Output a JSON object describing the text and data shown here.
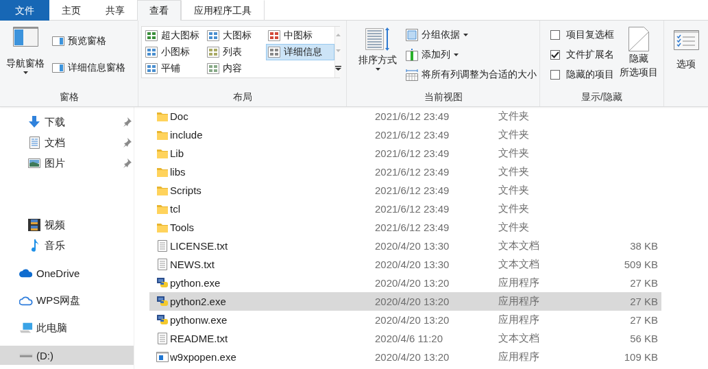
{
  "tabs": [
    {
      "label": "文件",
      "kind": "file",
      "selected": false
    },
    {
      "label": "主页",
      "kind": "normal",
      "selected": false
    },
    {
      "label": "共享",
      "kind": "normal",
      "selected": false
    },
    {
      "label": "查看",
      "kind": "normal",
      "selected": true
    },
    {
      "label": "应用程序工具",
      "kind": "context",
      "selected": false
    }
  ],
  "ribbon": {
    "panes": {
      "label": "窗格",
      "navigation_pane": "导航窗格",
      "preview_pane": "预览窗格",
      "details_pane": "详细信息窗格"
    },
    "layout": {
      "label": "布局",
      "items": [
        {
          "label": "超大图标",
          "kind": "xl",
          "selected": false
        },
        {
          "label": "大图标",
          "kind": "large",
          "selected": false
        },
        {
          "label": "中图标",
          "kind": "medium",
          "selected": false
        },
        {
          "label": "小图标",
          "kind": "small",
          "selected": false
        },
        {
          "label": "列表",
          "kind": "list",
          "selected": false
        },
        {
          "label": "详细信息",
          "kind": "details",
          "selected": true
        },
        {
          "label": "平铺",
          "kind": "tiles",
          "selected": false
        },
        {
          "label": "内容",
          "kind": "content",
          "selected": false
        }
      ]
    },
    "current_view": {
      "label": "当前视图",
      "sort_by": "排序方式",
      "group_by": "分组依据",
      "add_columns": "添加列",
      "size_all_columns": "将所有列调整为合适的大小"
    },
    "show_hide": {
      "label": "显示/隐藏",
      "checkboxes": [
        {
          "label": "项目复选框",
          "checked": false
        },
        {
          "label": "文件扩展名",
          "checked": true
        },
        {
          "label": "隐藏的项目",
          "checked": false
        }
      ],
      "hide_selected": [
        "隐藏",
        "所选项目"
      ]
    },
    "options": {
      "label": "选项"
    }
  },
  "sidebar": {
    "items": [
      {
        "label": "下载",
        "kind": "downloads",
        "pinned": true,
        "selected": false
      },
      {
        "label": "文档",
        "kind": "documents",
        "pinned": true,
        "selected": false
      },
      {
        "label": "图片",
        "kind": "pictures",
        "pinned": true,
        "selected": false
      },
      {
        "label": "视频",
        "kind": "videos",
        "pinned": false,
        "selected": false
      },
      {
        "label": "音乐",
        "kind": "music",
        "pinned": false,
        "selected": false
      },
      {
        "label": "OneDrive",
        "kind": "onedrive",
        "pinned": false,
        "selected": false
      },
      {
        "label": "WPS网盘",
        "kind": "wps",
        "pinned": false,
        "selected": false
      },
      {
        "label": "此电脑",
        "kind": "pc",
        "pinned": false,
        "selected": false
      },
      {
        "label": "(D:)",
        "kind": "drive",
        "pinned": false,
        "selected": true
      }
    ]
  },
  "files": [
    {
      "name": "Doc",
      "date": "2021/6/12 23:49",
      "type": "文件夹",
      "kind": "folder",
      "selected": false
    },
    {
      "name": "include",
      "date": "2021/6/12 23:49",
      "type": "文件夹",
      "kind": "folder",
      "selected": false
    },
    {
      "name": "Lib",
      "date": "2021/6/12 23:49",
      "type": "文件夹",
      "kind": "folder",
      "selected": false
    },
    {
      "name": "libs",
      "date": "2021/6/12 23:49",
      "type": "文件夹",
      "kind": "folder",
      "selected": false
    },
    {
      "name": "Scripts",
      "date": "2021/6/12 23:49",
      "type": "文件夹",
      "kind": "folder",
      "selected": false
    },
    {
      "name": "tcl",
      "date": "2021/6/12 23:49",
      "type": "文件夹",
      "kind": "folder",
      "selected": false
    },
    {
      "name": "Tools",
      "date": "2021/6/12 23:49",
      "type": "文件夹",
      "kind": "folder",
      "selected": false
    },
    {
      "name": "LICENSE.txt",
      "date": "2020/4/20 13:30",
      "type": "文本文档",
      "size": "38 KB",
      "kind": "text",
      "selected": false
    },
    {
      "name": "NEWS.txt",
      "date": "2020/4/20 13:30",
      "type": "文本文档",
      "size": "509 KB",
      "kind": "text",
      "selected": false
    },
    {
      "name": "python.exe",
      "date": "2020/4/20 13:20",
      "type": "应用程序",
      "size": "27 KB",
      "kind": "python",
      "selected": false
    },
    {
      "name": "python2.exe",
      "date": "2020/4/20 13:20",
      "type": "应用程序",
      "size": "27 KB",
      "kind": "python",
      "selected": true
    },
    {
      "name": "pythonw.exe",
      "date": "2020/4/20 13:20",
      "type": "应用程序",
      "size": "27 KB",
      "kind": "python",
      "selected": false
    },
    {
      "name": "README.txt",
      "date": "2020/4/6 11:20",
      "type": "文本文档",
      "size": "56 KB",
      "kind": "text",
      "selected": false
    },
    {
      "name": "w9xpopen.exe",
      "date": "2020/4/20 13:20",
      "type": "应用程序",
      "size": "109 KB",
      "kind": "app",
      "selected": false
    }
  ]
}
